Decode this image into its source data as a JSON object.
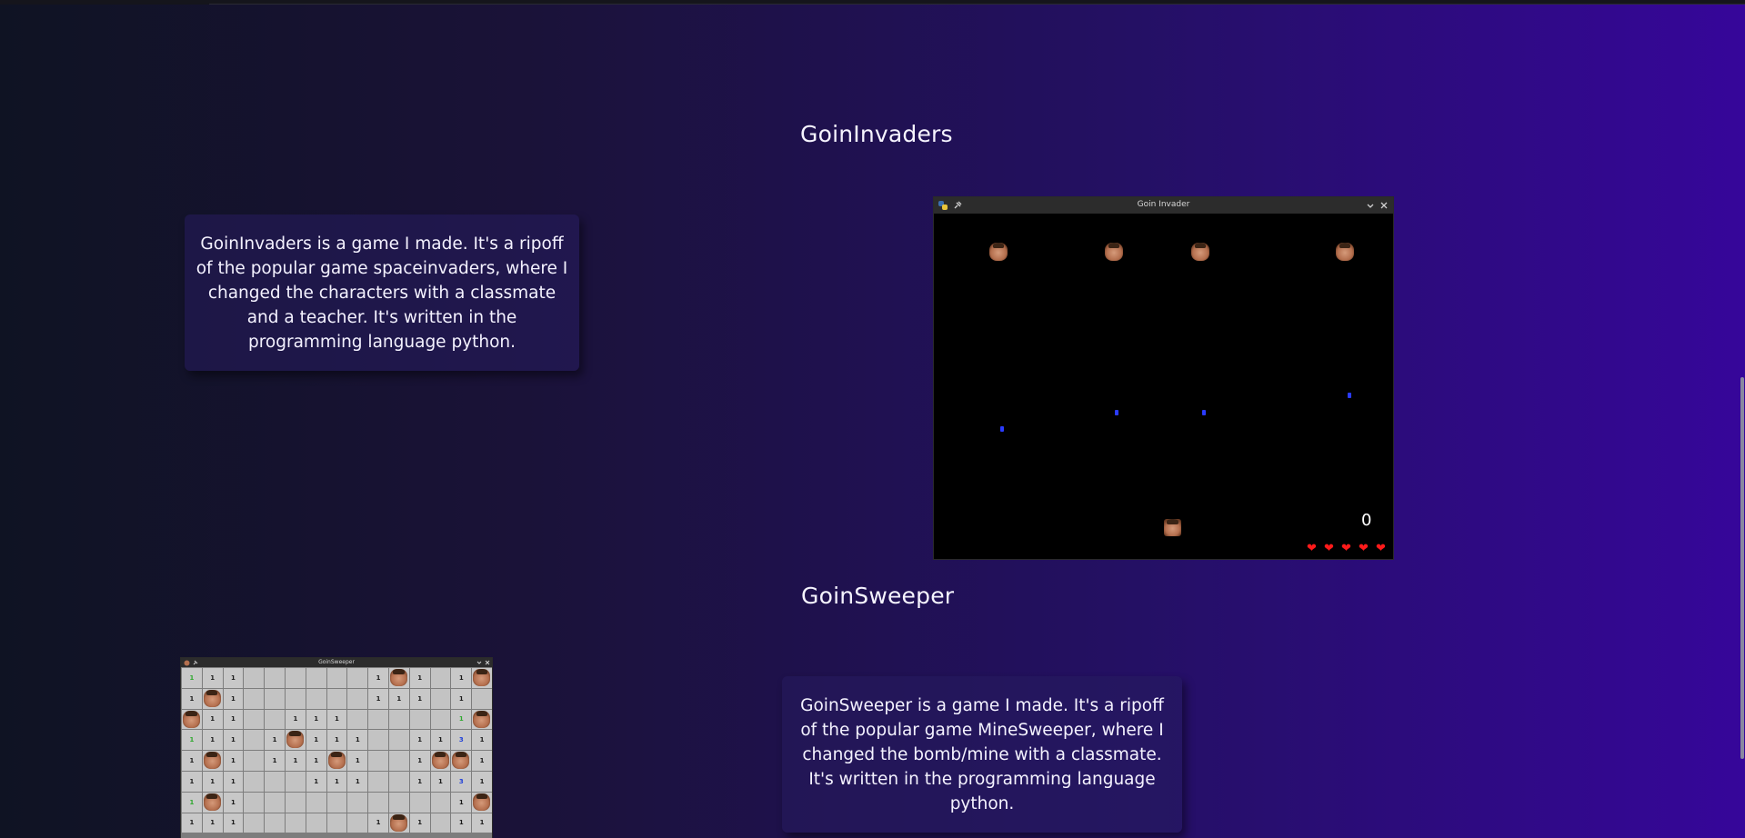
{
  "sections": [
    {
      "title": "GoinInvaders",
      "description": "GoinInvaders is a game I made. It's a ripoff of the popular game spaceinvaders, where I changed the characters with a classmate and a teacher. It's written in the programming language python.",
      "screenshot": {
        "window_title": "Goin Invader",
        "score": "0",
        "lives": 5
      }
    },
    {
      "title": "GoinSweeper",
      "description": "GoinSweeper is a game I made. It's a ripoff of the popular game MineSweeper, where I changed the bomb/mine with a classmate. It's written in the programming language python.",
      "screenshot": {
        "window_title": "GoinSweeper",
        "grid": [
          [
            "1",
            "1",
            "1",
            "",
            "",
            "",
            "",
            "",
            "",
            "1",
            "M",
            "1",
            "",
            "1",
            "M"
          ],
          [
            "1",
            "M",
            "1",
            "",
            "",
            "",
            "",
            "",
            "",
            "1",
            "1",
            "1",
            "",
            "1",
            ""
          ],
          [
            "M",
            "1",
            "1",
            "",
            "",
            "1",
            "1",
            "1",
            "",
            "",
            "",
            "",
            "",
            "1",
            "M"
          ],
          [
            "1",
            "1",
            "1",
            "",
            "1",
            "M",
            "1",
            "1",
            "1",
            "",
            "",
            "1",
            "1",
            "3",
            "1"
          ],
          [
            "1",
            "M",
            "1",
            "",
            "1",
            "1",
            "1",
            "M",
            "1",
            "",
            "",
            "1",
            "M",
            "M",
            "1"
          ],
          [
            "1",
            "1",
            "1",
            "",
            "",
            "",
            "1",
            "1",
            "1",
            "",
            "",
            "1",
            "1",
            "3",
            "1"
          ],
          [
            "1",
            "M",
            "1",
            "",
            "",
            "",
            "",
            "",
            "",
            "",
            "",
            "",
            "",
            "1",
            "M"
          ],
          [
            "1",
            "1",
            "1",
            "",
            "",
            "",
            "",
            "",
            "",
            "1",
            "M",
            "1",
            "",
            "1",
            "1"
          ]
        ]
      }
    }
  ],
  "colors": {
    "accent_text": "#f6f4ff",
    "number_one": "#1a1a1a",
    "number_green": "#2ea82e",
    "number_blue": "#1f3fd9",
    "heart": "#ff1a1a",
    "bullet": "#2a3bff"
  },
  "icons": {
    "app_icon": "python-logo-icon",
    "pin_icon": "pin-icon",
    "minimize_icon": "chevron-down-icon",
    "close_icon": "close-icon"
  }
}
